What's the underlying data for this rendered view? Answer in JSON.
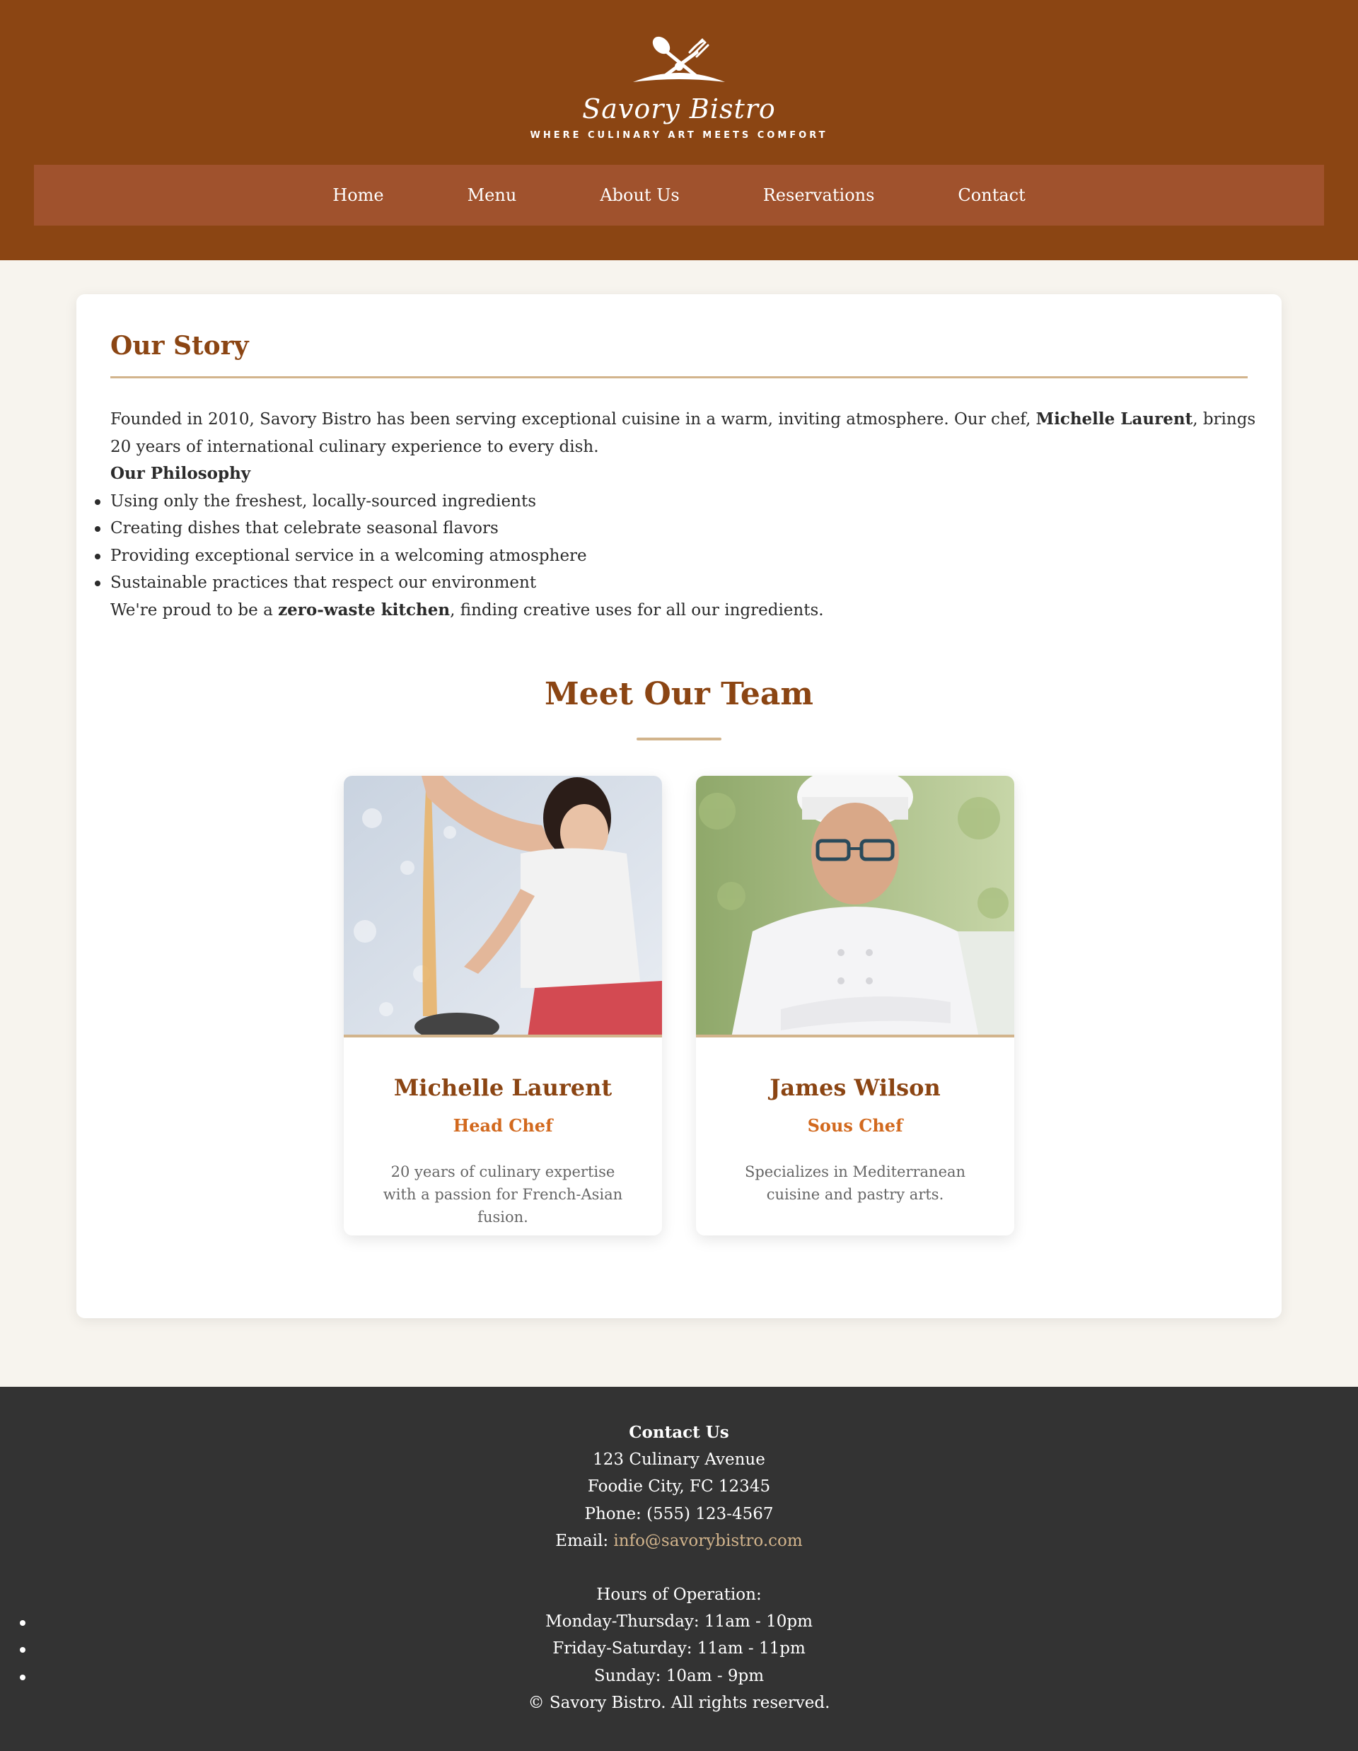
{
  "brand": {
    "name": "Savory Bistro",
    "tagline": "WHERE CULINARY ART MEETS COMFORT",
    "logo_icon": "crossed-fork-spoon-icon"
  },
  "nav": {
    "items": [
      "Home",
      "Menu",
      "About Us",
      "Reservations",
      "Contact"
    ]
  },
  "story": {
    "title": "Our Story",
    "intro_before": "Founded in 2010, Savory Bistro has been serving exceptional cuisine in a warm, inviting atmosphere. Our chef, ",
    "intro_bold": "Michelle Laurent",
    "intro_after": ", brings 20 years of international culinary experience to every dish.",
    "philosophy_heading": "Our Philosophy",
    "philosophy": [
      "Using only the freshest, locally-sourced ingredients",
      "Creating dishes that celebrate seasonal flavors",
      "Providing exceptional service in a welcoming atmosphere",
      "Sustainable practices that respect our environment"
    ],
    "closing_before": "We're proud to be a ",
    "closing_bold": "zero-waste kitchen",
    "closing_after": ", finding creative uses for all our ingredients."
  },
  "team": {
    "title": "Meet Our Team",
    "members": [
      {
        "name": "Michelle Laurent",
        "role": "Head Chef",
        "bio": "20 years of culinary expertise with a passion for French-Asian fusion."
      },
      {
        "name": "James Wilson",
        "role": "Sous Chef",
        "bio": "Specializes in Mediterranean cuisine and pastry arts."
      }
    ]
  },
  "footer": {
    "contact_heading": "Contact Us",
    "address1": "123 Culinary Avenue",
    "address2": "Foodie City, FC 12345",
    "phone": "Phone: (555) 123-4567",
    "email_label": "Email: ",
    "email": "info@savorybistro.com",
    "hours_heading": "Hours of Operation:",
    "hours": [
      "Monday-Thursday: 11am - 10pm",
      "Friday-Saturday: 11am - 11pm",
      "Sunday: 10am - 9pm"
    ],
    "copyright": "© Savory Bistro. All rights reserved."
  },
  "colors": {
    "brand_brown": "#8b4513",
    "nav_bg": "#a0522d",
    "accent_tan": "#d2b48c",
    "role_orange": "#d2691e",
    "footer_bg": "#333333"
  }
}
